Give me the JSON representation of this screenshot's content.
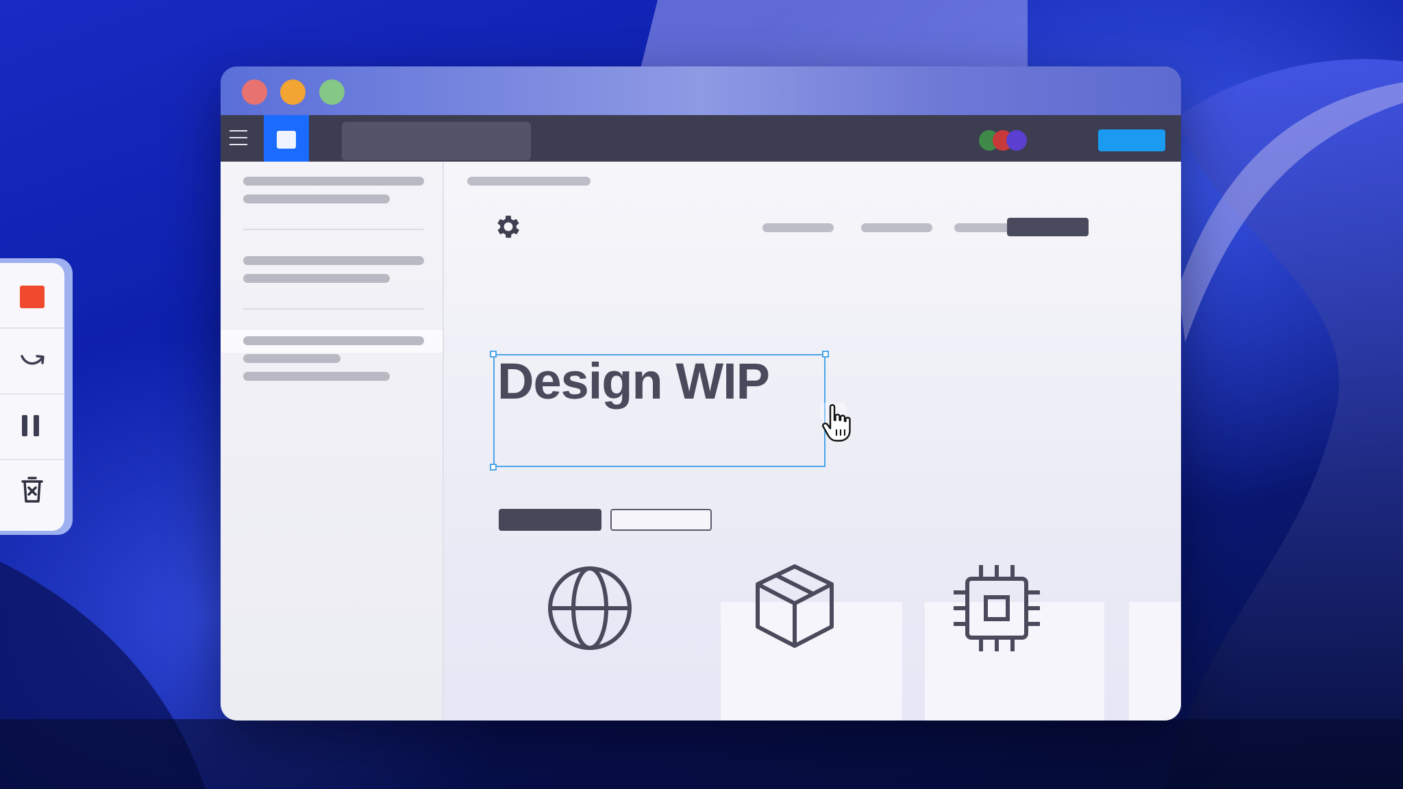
{
  "canvas": {
    "heading": "Design WIP"
  },
  "colors": {
    "close": "#e8726f",
    "minimize": "#f3a533",
    "maximize": "#84c787",
    "accent": "#1b6bff",
    "share": "#1a9af0",
    "record": "#f04a2e",
    "selection": "#4aa5e8"
  },
  "toolbar": {
    "collaborators": [
      "#3f8a4a",
      "#c83a3a",
      "#5a3fd0"
    ]
  },
  "cards": [
    {
      "icon": "globe-icon"
    },
    {
      "icon": "box-icon"
    },
    {
      "icon": "chip-icon"
    }
  ],
  "recorder": {
    "items": [
      "stop-record-icon",
      "redo-icon",
      "pause-icon",
      "trash-icon"
    ]
  }
}
